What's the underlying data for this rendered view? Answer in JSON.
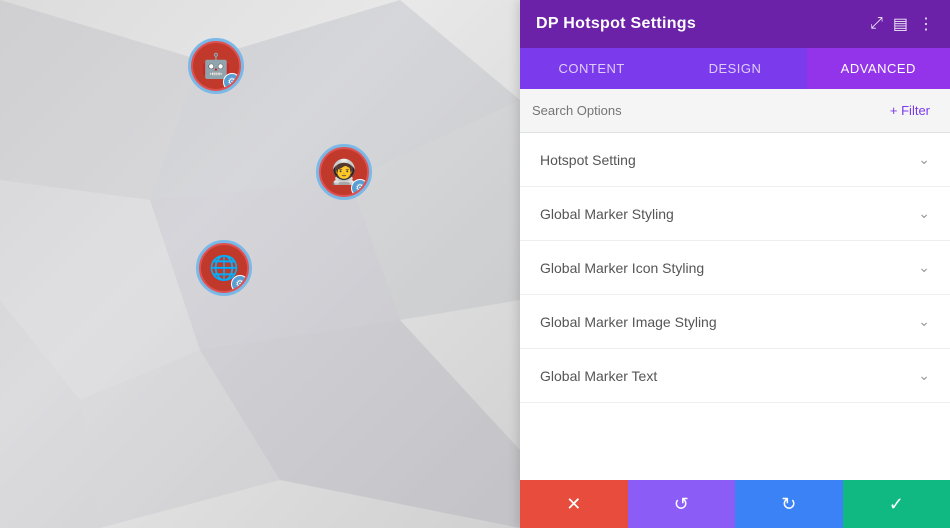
{
  "canvas": {
    "markers": [
      {
        "id": "marker-1",
        "icon": "🤖",
        "style": "top-left",
        "hasGear": true
      },
      {
        "id": "marker-2",
        "icon": "🧑‍🚀",
        "style": "top-right",
        "hasGear": true
      },
      {
        "id": "marker-3",
        "icon": "🌐",
        "style": "bottom-left",
        "hasGear": true
      }
    ]
  },
  "panel": {
    "title": "DP Hotspot Settings",
    "tabs": [
      {
        "id": "content",
        "label": "Content",
        "active": false
      },
      {
        "id": "design",
        "label": "Design",
        "active": false
      },
      {
        "id": "advanced",
        "label": "Advanced",
        "active": true
      }
    ],
    "search": {
      "placeholder": "Search Options"
    },
    "filter_label": "+ Filter",
    "sections": [
      {
        "id": "hotspot-setting",
        "label": "Hotspot Setting"
      },
      {
        "id": "global-marker-styling",
        "label": "Global Marker Styling"
      },
      {
        "id": "global-marker-icon",
        "label": "Global Marker Icon Styling"
      },
      {
        "id": "global-marker-image",
        "label": "Global Marker Image Styling"
      },
      {
        "id": "global-marker-text",
        "label": "Global Marker Text"
      }
    ],
    "toolbar": {
      "cancel": "✕",
      "undo": "↺",
      "redo": "↻",
      "save": "✓"
    }
  }
}
